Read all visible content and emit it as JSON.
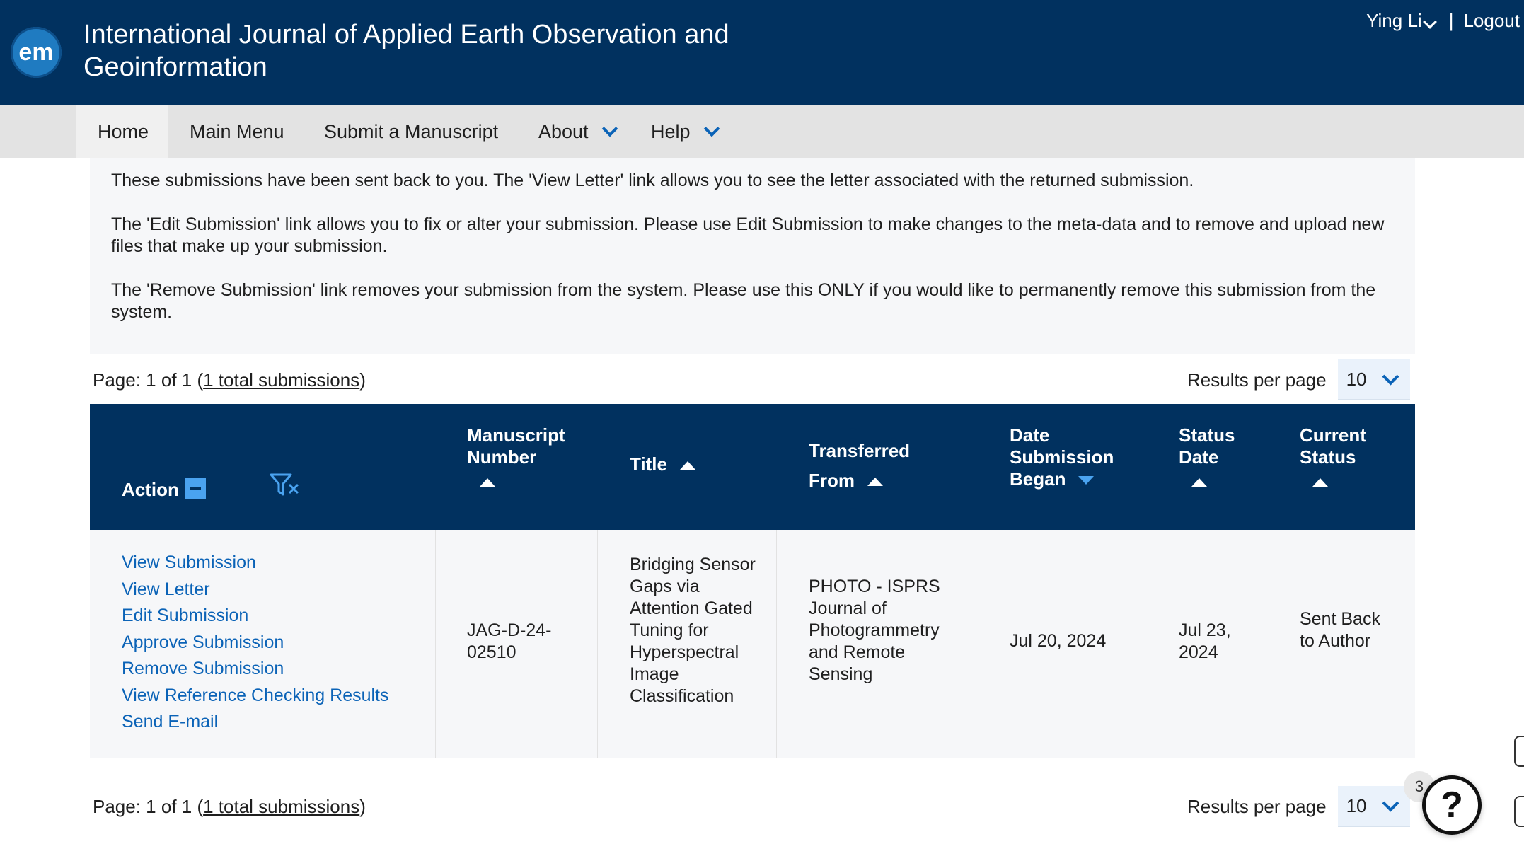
{
  "header": {
    "logo_text": "em",
    "journal_title": "International Journal of Applied Earth Observation and Geoinformation",
    "user_name": "Ying Li",
    "separator": "|",
    "logout_label": "Logout"
  },
  "nav": {
    "items": [
      {
        "label": "Home"
      },
      {
        "label": "Main Menu"
      },
      {
        "label": "Submit a Manuscript"
      },
      {
        "label": "About"
      },
      {
        "label": "Help"
      }
    ]
  },
  "info": {
    "para1": "These submissions have been sent back to you. The 'View Letter' link allows you to see the letter associated with the returned submission.",
    "para2": "The 'Edit Submission' link allows you to fix or alter your submission. Please use Edit Submission to make changes to the meta-data and to remove and upload new files that make up your submission.",
    "para3": "The 'Remove Submission' link removes your submission from the system. Please use this ONLY if you would like to permanently remove this submission from the system."
  },
  "pager": {
    "page_text": "Page: 1 of 1 (",
    "total_link": "1 total submissions",
    "close_paren": ")",
    "results_per_page_label": "Results per page",
    "results_per_page_value": "10"
  },
  "table": {
    "headers": {
      "action": "Action",
      "manuscript_number": "Manuscript Number",
      "title": "Title",
      "transferred_from": "Transferred From",
      "date_submission_began": "Date Submission Began",
      "status_date": "Status Date",
      "current_status": "Current Status"
    },
    "row": {
      "actions": [
        "View Submission",
        "View Letter",
        "Edit Submission",
        "Approve Submission",
        "Remove Submission",
        "View Reference Checking Results",
        "Send E-mail"
      ],
      "manuscript_number": "JAG-D-24-02510",
      "title": "Bridging Sensor Gaps via Attention Gated Tuning for Hyperspectral Image Classification",
      "transferred_from": "PHOTO - ISPRS Journal of Photogrammetry and Remote Sensing",
      "date_submission_began": "Jul 20, 2024",
      "status_date": "Jul 23, 2024",
      "current_status": "Sent Back to Author"
    }
  },
  "help": {
    "badge_count": "3",
    "icon_glyph": "?"
  }
}
